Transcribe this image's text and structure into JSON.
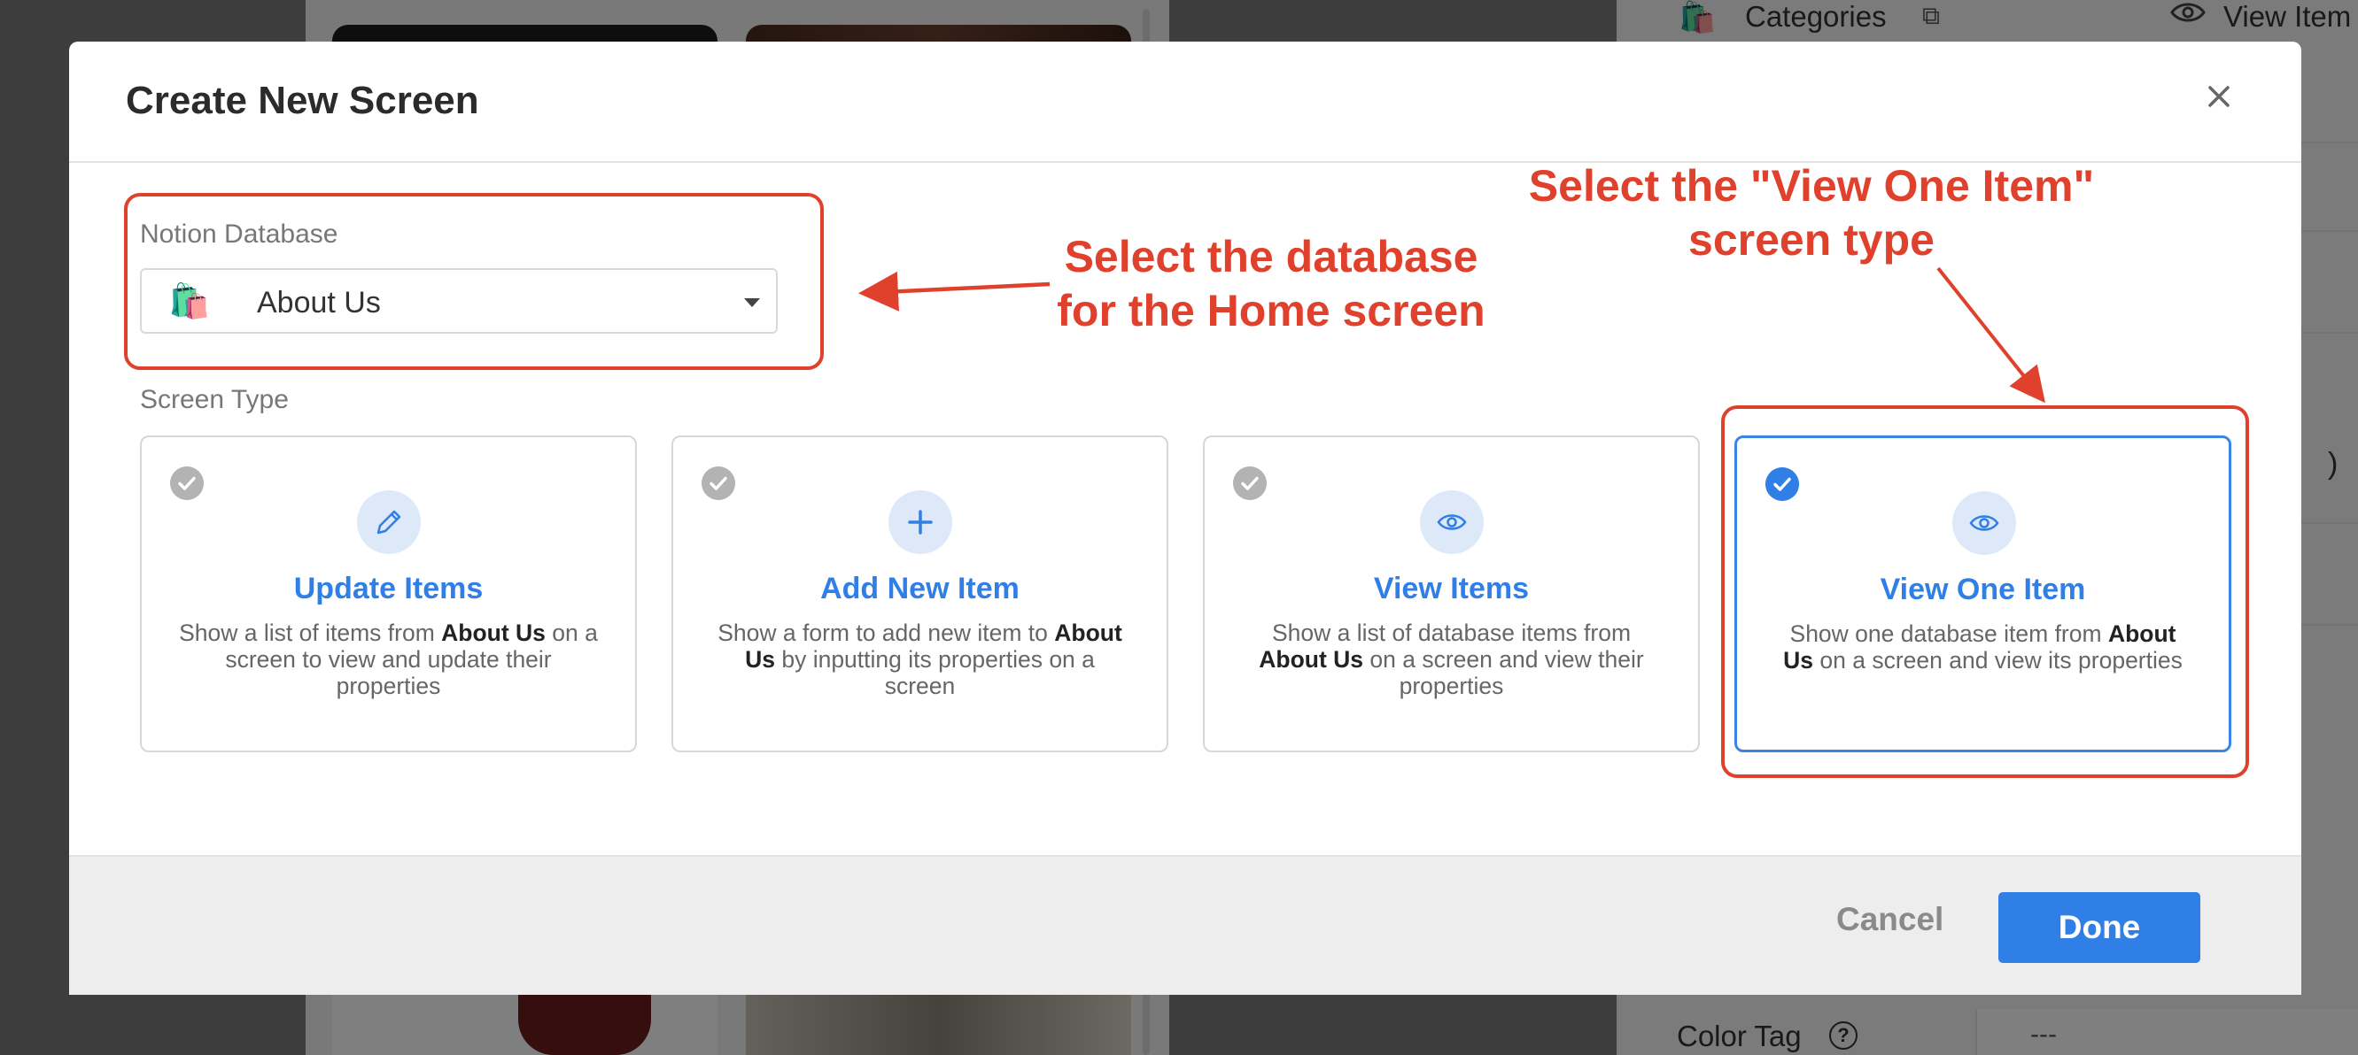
{
  "background": {
    "categories_label": "Categories",
    "view_label": "View Item",
    "paren_fragment": ")",
    "color_tag_label": "Color Tag",
    "color_tag_help": "?",
    "color_tag_value": "---"
  },
  "modal": {
    "title": "Create New Screen",
    "database_field": {
      "label": "Notion Database",
      "icon": "shopping-bags-emoji",
      "icon_glyph": "🛍️",
      "value": "About Us"
    },
    "screen_type_label": "Screen Type",
    "screen_types": [
      {
        "title": "Update Items",
        "icon": "pencil-icon",
        "desc_pre": "Show a list of items from ",
        "desc_bold": "About Us",
        "desc_post": " on a screen to view and update their properties",
        "selected": false
      },
      {
        "title": "Add New Item",
        "icon": "plus-icon",
        "desc_pre": "Show a form to add new item to ",
        "desc_bold": "About Us",
        "desc_post": " by inputting its properties on a screen",
        "selected": false
      },
      {
        "title": "View Items",
        "icon": "eye-icon",
        "desc_pre": "Show a list of database items from ",
        "desc_bold": "About Us",
        "desc_post": " on a screen and view their properties",
        "selected": false
      },
      {
        "title": "View One Item",
        "icon": "eye-icon",
        "desc_pre": "Show one database item from ",
        "desc_bold": "About Us",
        "desc_post": " on a screen and view its properties",
        "selected": true
      }
    ],
    "footer": {
      "cancel_label": "Cancel",
      "done_label": "Done"
    }
  },
  "annotations": {
    "database_note_line1": "Select the database",
    "database_note_line2": "for the Home screen",
    "type_note_line1": "Select the \"View One Item\"",
    "type_note_line2": "screen type",
    "color": "#e0412c"
  },
  "colors": {
    "accent": "#2f7fe6",
    "selected_border": "#3a84e3",
    "icon_bg": "#dde9f9",
    "check_inactive": "#b3b3b3",
    "footer_bg": "#ededed"
  }
}
